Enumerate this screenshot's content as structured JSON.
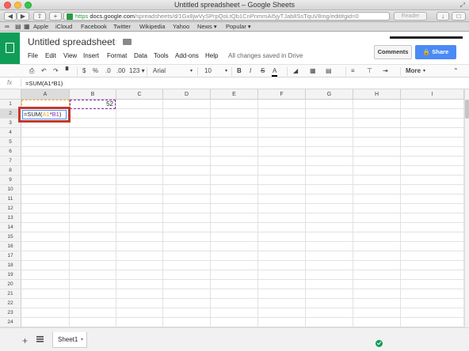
{
  "window": {
    "title": "Untitled spreadsheet – Google Sheets"
  },
  "browser": {
    "url_scheme": "https",
    "url_host": "docs.google.com",
    "url_path": "/spreadsheets/d/1Gx8jwVySPrpQoLtQb1CnPnmmAi5jyTJab8SsTquV8mg/edit#gid=0",
    "reader_label": "Reader",
    "bookmarks": [
      "Apple",
      "iCloud",
      "Facebook",
      "Twitter",
      "Wikipedia",
      "Yahoo",
      "News ▾",
      "Popular ▾"
    ]
  },
  "doc": {
    "title": "Untitled spreadsheet",
    "menus": [
      "File",
      "Edit",
      "View",
      "Insert",
      "Format",
      "Data",
      "Tools",
      "Add-ons",
      "Help"
    ],
    "save_status": "All changes saved in Drive",
    "comments_label": "Comments",
    "share_label": "Share"
  },
  "toolbar": {
    "percent": "%",
    "decimal_dec": ".0",
    "decimal_inc": ".00",
    "number_format": "123 ▾",
    "font": "Arial",
    "font_size": "10",
    "bold": "B",
    "italic": "I",
    "strike": "S",
    "text_color": "A",
    "more_label": "More"
  },
  "formula_bar": {
    "label": "fx",
    "content": "=SUM(A1*B1)"
  },
  "grid": {
    "columns": [
      "A",
      "B",
      "C",
      "D",
      "E",
      "F",
      "G",
      "H",
      "I"
    ],
    "rows": [
      "1",
      "2",
      "3",
      "4",
      "5",
      "6",
      "7",
      "8",
      "9",
      "10",
      "11",
      "12",
      "13",
      "14",
      "15",
      "16",
      "17",
      "18",
      "19",
      "20",
      "21",
      "22",
      "23",
      "24"
    ],
    "cells": {
      "B1": "52",
      "A2_prefix": "=SUM(",
      "A2_ref1": "A1",
      "A2_op": "*",
      "A2_ref2": "B1",
      "A2_suffix": ")"
    }
  },
  "sheets": {
    "tabs": [
      "Sheet1"
    ]
  },
  "colors": {
    "sheets_green": "#0f9d58",
    "share_blue": "#4a8af4",
    "highlight_red": "#c0392b"
  }
}
